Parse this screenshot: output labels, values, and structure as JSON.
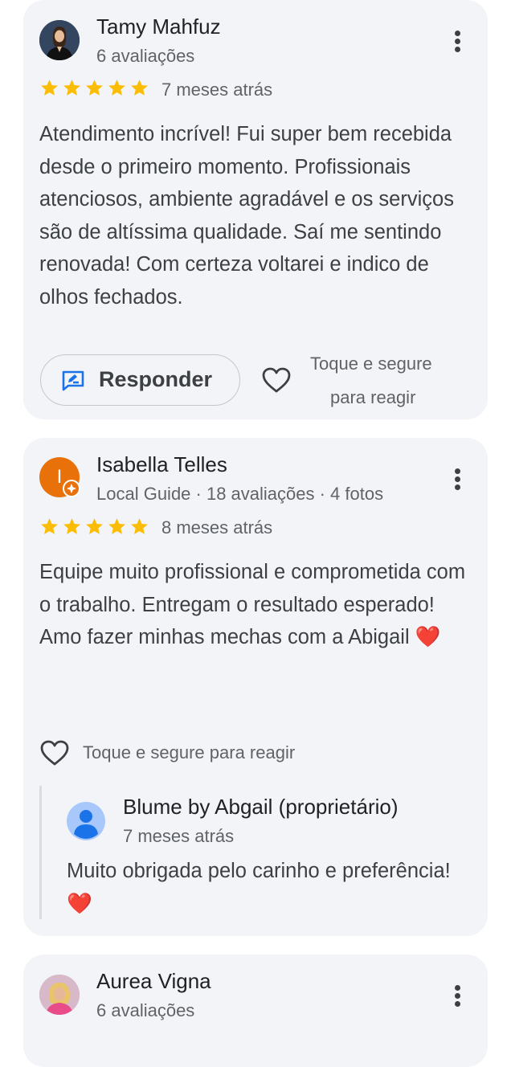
{
  "colors": {
    "card_bg": "#f3f4f8",
    "star": "#fbbc04",
    "primary_text": "#202124",
    "secondary_text": "#5f6368",
    "accent_blue": "#1a73e8",
    "local_guide_orange": "#e8710a",
    "heart_red": "#e53935"
  },
  "reviews": [
    {
      "author": "Tamy Mahfuz",
      "meta": "6 avaliações",
      "rating": 5,
      "date": "7 meses atrás",
      "text_lines": [
        "Atendimento incrível! Fui super bem recebida desde o primeiro momento. Profissionais atenciosos, ambiente agradável e os serviços são de altíssima qualidade. Saí me sentindo renovada! Com certeza voltarei e indico de olhos fechados."
      ],
      "reply_label": "Responder",
      "react_hint_line1": "Toque e segure",
      "react_hint_line2": "para reagir",
      "icons": [
        "avatar-photo",
        "more-vert-icon",
        "star-icon",
        "rate-review-icon",
        "heart-outline-icon"
      ]
    },
    {
      "author": "Isabella Telles",
      "avatar_letter": "I",
      "meta": "Local Guide · 18 avaliações · 4 fotos",
      "rating": 5,
      "date": "8 meses atrás",
      "text_lines": [
        "Equipe muito profissional e comprometida com o trabalho. Entregam o resultado esperado!",
        "Amo fazer minhas mechas com a Abigail ❤️"
      ],
      "react_hint": "Toque e segure para reagir",
      "owner_reply": {
        "name": "Blume by Abgail (proprietário)",
        "date": "7 meses atrás",
        "text": "Muito obrigada pelo carinho e preferência! ❤️"
      },
      "icons": [
        "local-guide-badge-icon",
        "more-vert-icon",
        "star-icon",
        "heart-outline-icon",
        "person-icon"
      ]
    },
    {
      "author": "Aurea Vigna",
      "meta": "6 avaliações",
      "icons": [
        "avatar-photo",
        "more-vert-icon"
      ]
    }
  ]
}
